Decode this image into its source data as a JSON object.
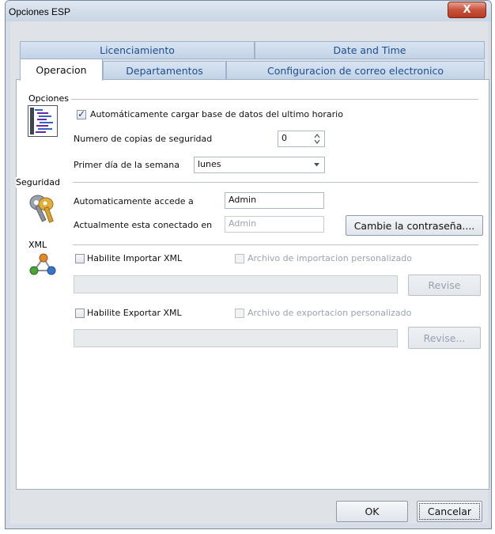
{
  "window": {
    "title": "Opciones ESP",
    "close_glyph": "X"
  },
  "tabs_top": [
    {
      "label": "Licenciamiento"
    },
    {
      "label": "Date and Time"
    }
  ],
  "tabs_bottom": [
    {
      "label": "Operacion",
      "active": true
    },
    {
      "label": "Departamentos"
    },
    {
      "label": "Configuracion de correo electronico"
    }
  ],
  "opciones": {
    "group_label": "Opciones",
    "icon": "list-settings-icon",
    "auto_load_label": "Automáticamente cargar base de datos del ultimo horario",
    "auto_load_checked": true,
    "copies_label": "Numero de copias de seguridad",
    "copies_value": "0",
    "first_day_label": "Primer día de la semana",
    "first_day_value": "lunes"
  },
  "seguridad": {
    "group_label": "Seguridad",
    "icon": "keys-icon",
    "auto_access_label": "Automaticamente accede a",
    "auto_access_value": "Admin",
    "connected_label": "Actualmente esta conectado en",
    "connected_value": "Admin",
    "change_password_button": "Cambie la contraseña...."
  },
  "xml": {
    "group_label": "XML",
    "icon": "network-nodes-icon",
    "import_enable_label": "Habilite Importar XML",
    "import_custom_label": "Archivo de importacion personalizado",
    "import_browse_button": "Revise",
    "export_enable_label": "Habilite Exportar XML",
    "export_custom_label": "Archivo de exportacion personalizado",
    "export_browse_button": "Revise..."
  },
  "footer": {
    "ok_button": "OK",
    "cancel_button": "Cancelar"
  },
  "colors": {
    "accent": "#1e4f8f",
    "close": "#c8533c",
    "panel_border": "#9fb2c9"
  }
}
